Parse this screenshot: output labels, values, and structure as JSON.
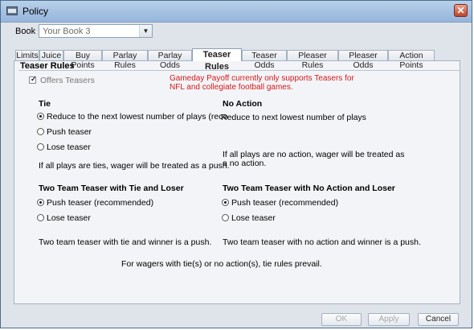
{
  "window": {
    "title": "Policy",
    "close_symbol": "✕"
  },
  "book": {
    "label": "Book",
    "value": "Your Book 3",
    "arrow": "▼"
  },
  "tabs": [
    {
      "label": "Limits"
    },
    {
      "label": "Juice"
    },
    {
      "label": "Buy Points"
    },
    {
      "label": "Parlay Rules"
    },
    {
      "label": "Parlay Odds"
    },
    {
      "label": "Teaser Rules",
      "active": true
    },
    {
      "label": "Teaser Odds"
    },
    {
      "label": "Pleaser Rules"
    },
    {
      "label": "Pleaser Odds"
    },
    {
      "label": "Action Points"
    }
  ],
  "group": {
    "title": "Teaser Rules",
    "offers_teasers_label": "Offers Teasers",
    "offers_teasers_checked": true,
    "warning": "Gameday Payoff currently only supports Teasers for NFL and collegiate football games."
  },
  "tie": {
    "heading": "Tie",
    "options": [
      {
        "label": "Reduce to the next lowest number of plays (reco",
        "selected": true
      },
      {
        "label": "Push teaser",
        "selected": false
      },
      {
        "label": "Lose teaser",
        "selected": false
      }
    ],
    "note": "If all plays are ties, wager will be treated as a push."
  },
  "no_action": {
    "heading": "No Action",
    "value": "Reduce to next lowest number of plays",
    "note_line1": "If all plays are no action, wager will be treated as",
    "note_line2": "a no action."
  },
  "two_team_tie": {
    "heading": "Two Team Teaser with Tie and Loser",
    "options": [
      {
        "label": "Push teaser (recommended)",
        "selected": true
      },
      {
        "label": "Lose teaser",
        "selected": false
      }
    ],
    "note": "Two team teaser with tie and winner is a push."
  },
  "two_team_no_action": {
    "heading": "Two Team Teaser with No Action and Loser",
    "options": [
      {
        "label": "Push teaser (recommended)",
        "selected": true
      },
      {
        "label": "Lose teaser",
        "selected": false
      }
    ],
    "note": "Two team teaser with no action and winner is a push."
  },
  "footer_note": "For wagers with tie(s) or no action(s), tie rules prevail.",
  "buttons": {
    "ok": "OK",
    "apply": "Apply",
    "cancel": "Cancel"
  }
}
